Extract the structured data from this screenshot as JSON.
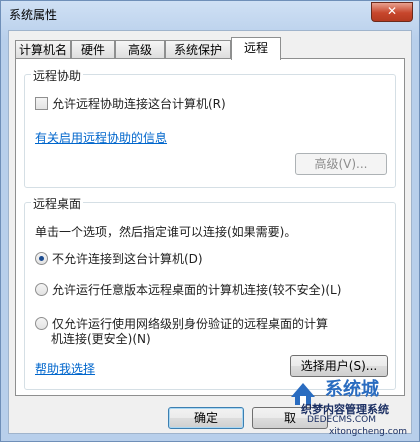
{
  "window": {
    "title": "系统属性",
    "close_glyph": "✕"
  },
  "tabs": [
    {
      "label": "计算机名",
      "active": false
    },
    {
      "label": "硬件",
      "active": false
    },
    {
      "label": "高级",
      "active": false
    },
    {
      "label": "系统保护",
      "active": false
    },
    {
      "label": "远程",
      "active": true
    }
  ],
  "remote_assistance": {
    "group_title": "远程协助",
    "allow_checkbox_label": "允许远程协助连接这台计算机(R)",
    "allow_checked": false,
    "info_link": "有关启用远程协助的信息",
    "advanced_button": "高级(V)..."
  },
  "remote_desktop": {
    "group_title": "远程桌面",
    "instruction": "单击一个选项，然后指定谁可以连接(如果需要)。",
    "options": [
      {
        "label": "不允许连接到这台计算机(D)",
        "checked": true
      },
      {
        "label": "允许运行任意版本远程桌面的计算机连接(较不安全)(L)",
        "checked": false
      },
      {
        "label_line1": "仅允许运行使用网络级别身份验证的远程桌面的计算",
        "label_line2": "机连接(更安全)(N)",
        "checked": false
      }
    ],
    "help_link": "帮助我选择",
    "select_users_button": "选择用户(S)..."
  },
  "footer": {
    "ok_button": "确定",
    "cancel_button_partial": "取"
  },
  "watermark": {
    "title": "系统城",
    "subtitle": "织梦内容管理系统",
    "url1": "DEDECMS.COM",
    "url2": "xitongcheng.com"
  },
  "colors": {
    "link": "#0066cc",
    "close_button": "#c7462c",
    "watermark_blue": "#2a6cc0"
  }
}
